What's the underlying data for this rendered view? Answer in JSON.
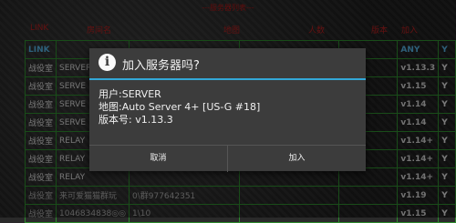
{
  "screen_title": "---服务器列表---",
  "columns": [
    "LINK",
    "房间名",
    "地图",
    "人数",
    "版本",
    "加入"
  ],
  "table_rows": [
    [
      "LINK",
      "",
      "",
      "",
      "",
      "ANY",
      "Y"
    ],
    [
      "战役室",
      "SERVER",
      "",
      "",
      "",
      "v1.13.3",
      "Y"
    ],
    [
      "战役室",
      "SERVE",
      "",
      "",
      "",
      "v1.15",
      "Y"
    ],
    [
      "战役室",
      "SERVE",
      "",
      "",
      "",
      "v1.14",
      "Y"
    ],
    [
      "战役室",
      "SERVE",
      "",
      "",
      "",
      "v1.14",
      "Y"
    ],
    [
      "战役室",
      "RELAY",
      "",
      "",
      "",
      "v1.14+",
      "Y"
    ],
    [
      "战役室",
      "RELAY",
      "",
      "",
      "",
      "v1.14+",
      "Y"
    ],
    [
      "战役室",
      "RELAY",
      "",
      "",
      "",
      "v1.14+",
      "Y"
    ],
    [
      "战役室",
      "来可爱猫猫群玩",
      "0\\群977642351",
      "",
      "",
      "v1.19",
      "Y"
    ],
    [
      "战役室",
      "1046834838◎◎",
      "1\\10",
      "",
      "",
      "v1.15",
      "Y"
    ]
  ],
  "dialog": {
    "title": "加入服务器吗?",
    "line_user": "用户:SERVER",
    "line_map": "地图:Auto Server 4+ [US-G #18]",
    "line_version": "版本号: v1.13.3",
    "cancel_label": "取消",
    "join_label": "加入",
    "icon": "info-icon",
    "accent_color": "#33a8d8"
  }
}
